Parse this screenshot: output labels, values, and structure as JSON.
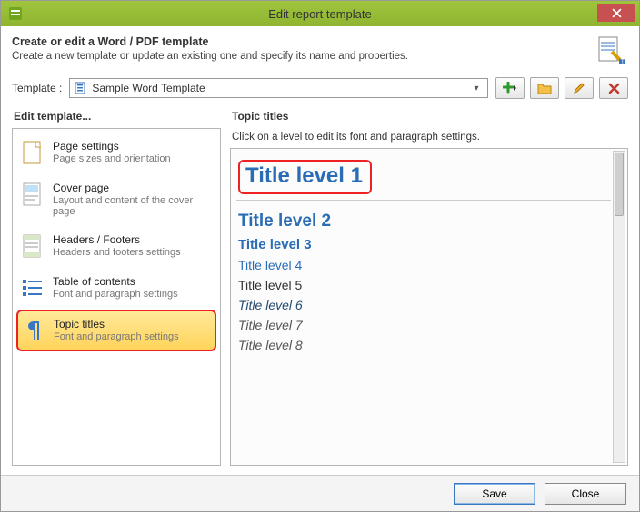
{
  "window": {
    "title": "Edit report template"
  },
  "header": {
    "title": "Create or edit a Word / PDF template",
    "subtitle": "Create a new template or update an existing one and specify its name and properties."
  },
  "template_row": {
    "label": "Template :",
    "selected": "Sample Word Template"
  },
  "left_panel": {
    "title": "Edit template...",
    "items": [
      {
        "title": "Page settings",
        "sub": "Page sizes and orientation",
        "icon": "page"
      },
      {
        "title": "Cover page",
        "sub": "Layout and content of the cover page",
        "icon": "cover"
      },
      {
        "title": "Headers / Footers",
        "sub": "Headers and footers settings",
        "icon": "header"
      },
      {
        "title": "Table of contents",
        "sub": "Font and paragraph settings",
        "icon": "toc"
      },
      {
        "title": "Topic titles",
        "sub": "Font and paragraph settings",
        "icon": "pilcrow",
        "selected": true
      }
    ]
  },
  "right_panel": {
    "title": "Topic titles",
    "hint": "Click on a level to edit its font and paragraph settings.",
    "levels": [
      "Title level 1",
      "Title level 2",
      "Title level 3",
      "Title level 4",
      "Title level 5",
      "Title level 6",
      "Title level 7",
      "Title level 8"
    ]
  },
  "footer": {
    "save": "Save",
    "close": "Close"
  }
}
